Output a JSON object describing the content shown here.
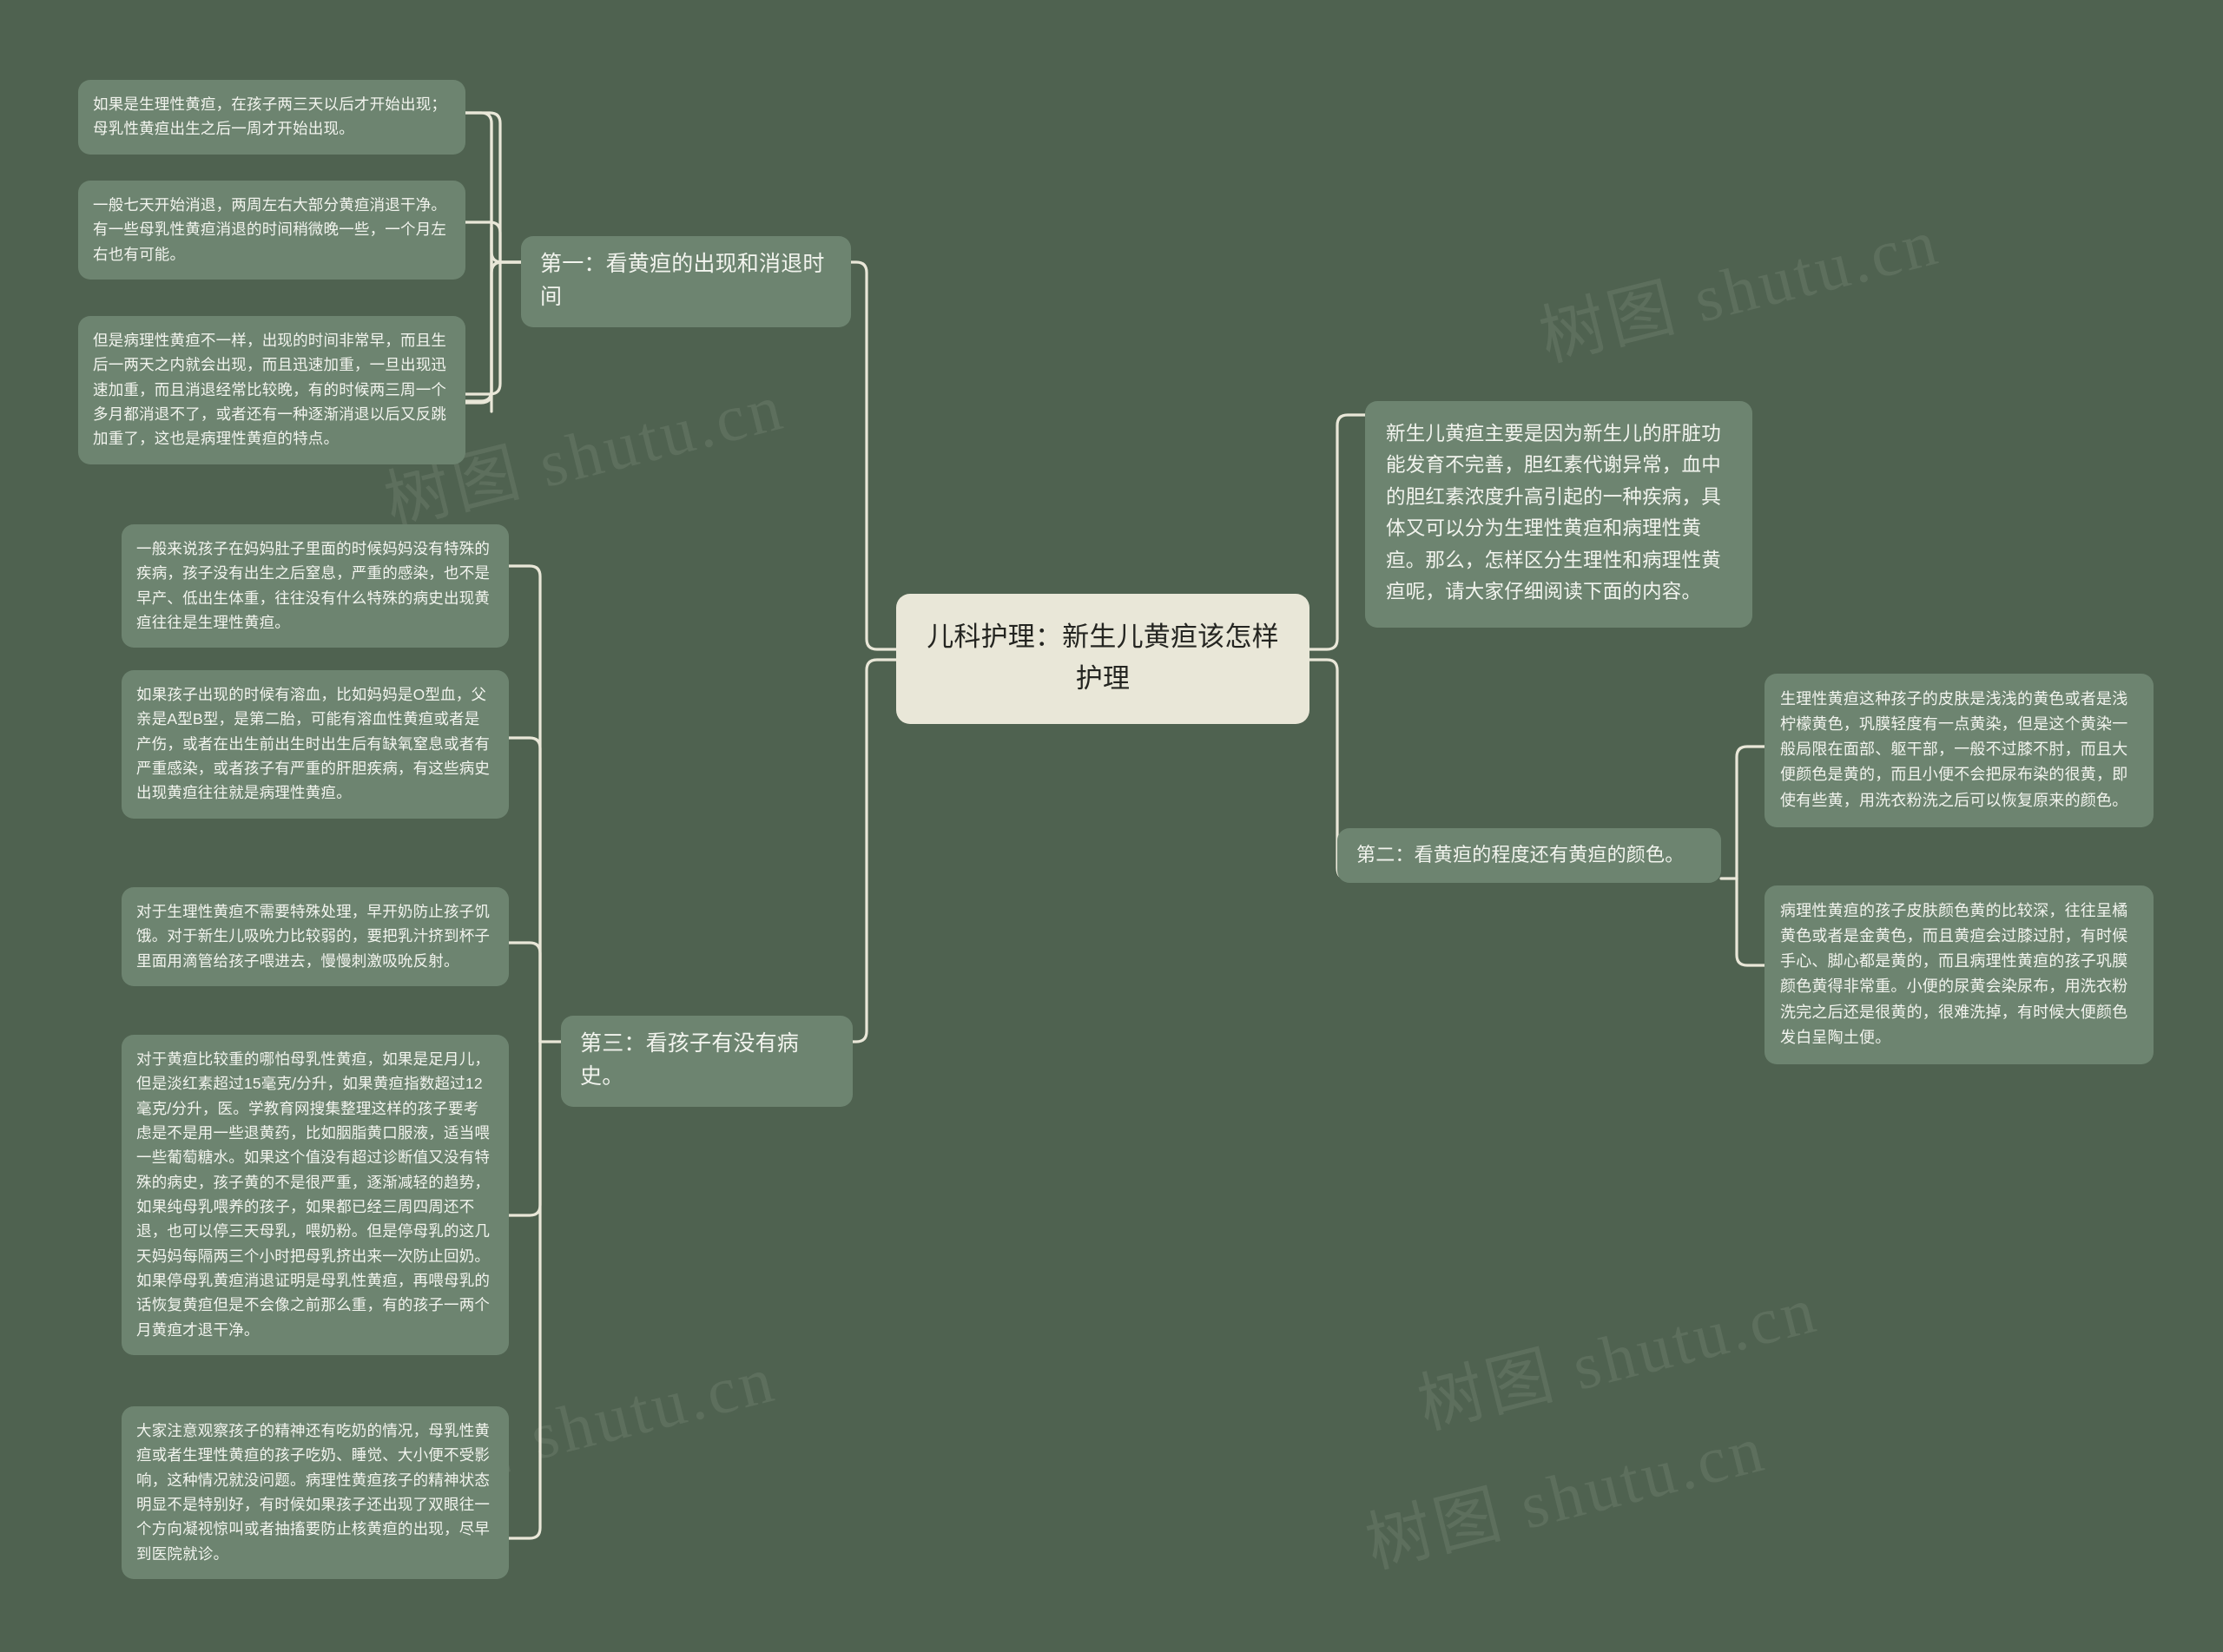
{
  "theme": {
    "background": "#4f6250",
    "node_fill": "#6d8470",
    "node_text": "#f2f4ee",
    "root_fill": "#e9e7d8",
    "root_text": "#242521",
    "connector": "#e9e7d8"
  },
  "root": {
    "title": "儿科护理：新生儿黄疸该怎样护理"
  },
  "intro": {
    "text": "新生儿黄疸主要是因为新生儿的肝脏功能发育不完善，胆红素代谢异常，血中的胆红素浓度升高引起的一种疾病，具体又可以分为生理性黄疸和病理性黄疸。那么，怎样区分生理性和病理性黄疸呢，请大家仔细阅读下面的内容。"
  },
  "branches": [
    {
      "id": "branch-1",
      "label": "第一：看黄疸的出现和消退时间",
      "leaves": [
        "如果是生理性黄疸，在孩子两三天以后才开始出现；母乳性黄疸出生之后一周才开始出现。",
        "一般七天开始消退，两周左右大部分黄疸消退干净。有一些母乳性黄疸消退的时间稍微晚一些，一个月左右也有可能。",
        "但是病理性黄疸不一样，出现的时间非常早，而且生后一两天之内就会出现，而且迅速加重，一旦出现迅速加重，而且消退经常比较晚，有的时候两三周一个多月都消退不了，或者还有一种逐渐消退以后又反跳加重了，这也是病理性黄疸的特点。"
      ]
    },
    {
      "id": "branch-3",
      "label": "第三：看孩子有没有病史。",
      "leaves": [
        "一般来说孩子在妈妈肚子里面的时候妈妈没有特殊的疾病，孩子没有出生之后窒息，严重的感染，也不是早产、低出生体重，往往没有什么特殊的病史出现黄疸往往是生理性黄疸。",
        "如果孩子出现的时候有溶血，比如妈妈是O型血，父亲是A型B型，是第二胎，可能有溶血性黄疸或者是产伤，或者在出生前出生时出生后有缺氧窒息或者有严重感染，或者孩子有严重的肝胆疾病，有这些病史出现黄疸往往就是病理性黄疸。",
        "对于生理性黄疸不需要特殊处理，早开奶防止孩子饥饿。对于新生儿吸吮力比较弱的，要把乳汁挤到杯子里面用滴管给孩子喂进去，慢慢刺激吸吮反射。",
        "对于黄疸比较重的哪怕母乳性黄疸，如果是足月儿，但是淡红素超过15毫克/分升，如果黄疸指数超过12毫克/分升，医。学教育网搜集整理这样的孩子要考虑是不是用一些退黄药，比如胭脂黄口服液，适当喂一些葡萄糖水。如果这个值没有超过诊断值又没有特殊的病史，孩子黄的不是很严重，逐渐减轻的趋势，如果纯母乳喂养的孩子，如果都已经三周四周还不退，也可以停三天母乳，喂奶粉。但是停母乳的这几天妈妈每隔两三个小时把母乳挤出来一次防止回奶。如果停母乳黄疸消退证明是母乳性黄疸，再喂母乳的话恢复黄疸但是不会像之前那么重，有的孩子一两个月黄疸才退干净。",
        "大家注意观察孩子的精神还有吃奶的情况，母乳性黄疸或者生理性黄疸的孩子吃奶、睡觉、大小便不受影响，这种情况就没问题。病理性黄疸孩子的精神状态明显不是特别好，有时候如果孩子还出现了双眼往一个方向凝视惊叫或者抽搐要防止核黄疸的出现，尽早到医院就诊。"
      ]
    },
    {
      "id": "branch-2",
      "label": "第二：看黄疸的程度还有黄疸的颜色。",
      "leaves": [
        "生理性黄疸这种孩子的皮肤是浅浅的黄色或者是浅柠檬黄色，巩膜轻度有一点黄染，但是这个黄染一般局限在面部、躯干部，一般不过膝不肘，而且大便颜色是黄的，而且小便不会把尿布染的很黄，即使有些黄，用洗衣粉洗之后可以恢复原来的颜色。",
        "病理性黄疸的孩子皮肤颜色黄的比较深，往往呈橘黄色或者是金黄色，而且黄疸会过膝过肘，有时候手心、脚心都是黄的，而且病理性黄疸的孩子巩膜颜色黄得非常重。小便的尿黄会染尿布，用洗衣粉洗完之后还是很黄的，很难洗掉，有时候大便颜色发白呈陶土便。"
      ]
    }
  ],
  "watermarks": [
    "树图 shutu.cn",
    "树图 shutu.cn",
    "树图 shutu.cn",
    "树图 shutu.cn",
    "树图 shutu.cn"
  ]
}
